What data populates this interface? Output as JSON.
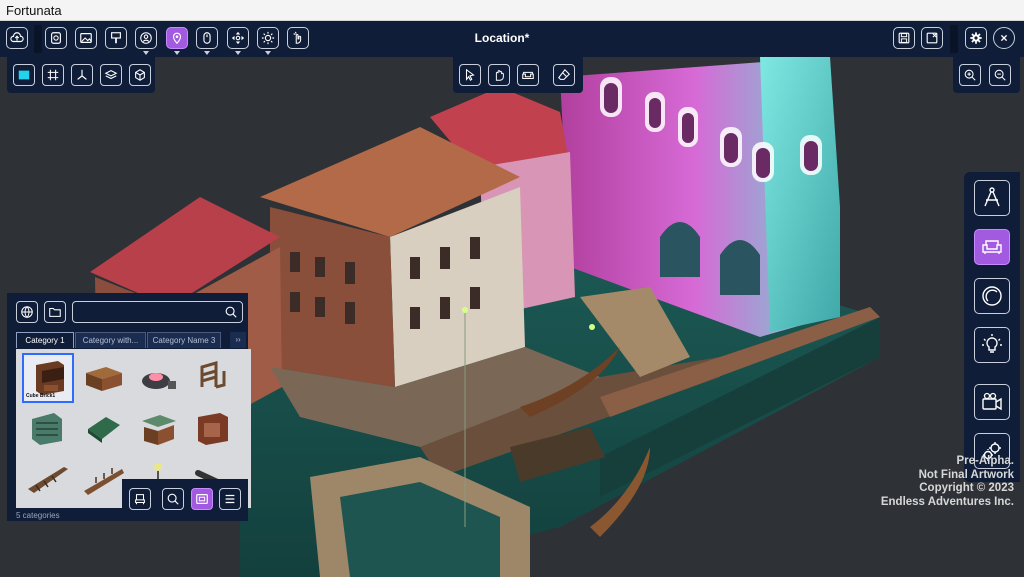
{
  "window": {
    "title": "Fortunata"
  },
  "header": {
    "location_title": "Location*"
  },
  "topbar_icons": [
    "cloud-upload-icon",
    "info-icon",
    "image-icon",
    "paint-bucket-icon",
    "character-icon",
    "location-pin-icon",
    "mouse-icon",
    "move-icon",
    "gear-burst-icon",
    "hand-point-icon"
  ],
  "library": {
    "search_placeholder": "",
    "tabs": [
      "Category 1",
      "Category with...",
      "Category Name 3"
    ],
    "more_label": "››",
    "selected_item": "Cube Brick1",
    "footer": "5 categories"
  },
  "watermark": [
    "Pre-Alpha.",
    "Not Final Artwork",
    "Copyright © 2023",
    "Endless Adventures Inc."
  ],
  "colors": {
    "panel": "#0f1d38",
    "accent": "#a25ae0",
    "selection": "#2f6bff"
  }
}
